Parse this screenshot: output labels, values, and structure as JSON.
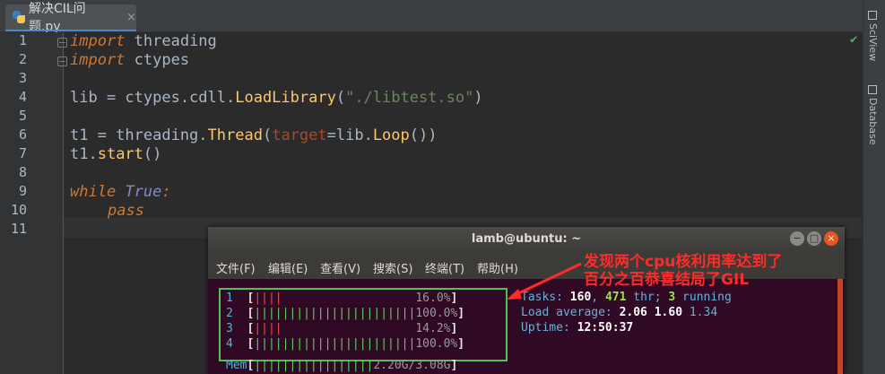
{
  "editor": {
    "tab": {
      "title": "解决CIL问题.py",
      "close": "×"
    },
    "side_tools": [
      "SciView",
      "Database"
    ],
    "line_numbers": [
      "1",
      "2",
      "3",
      "4",
      "5",
      "6",
      "7",
      "8",
      "9",
      "10",
      "11"
    ],
    "code": {
      "l1_kw": "import",
      "l1_rest": " threading",
      "l2_kw": "import",
      "l2_rest": " ctypes",
      "l4_a": "lib = ctypes.cdll.",
      "l4_fn": "LoadLibrary",
      "l4_b": "(",
      "l4_str": "\"./libtest.so\"",
      "l4_c": ")",
      "l6_a": "t1 = threading.",
      "l6_fn": "Thread",
      "l6_b": "(",
      "l6_par": "target",
      "l6_c": "=lib.",
      "l6_meth": "Loop",
      "l6_d": "())",
      "l7_a": "t1.",
      "l7_meth": "start",
      "l7_b": "()",
      "l9_kw": "while",
      "l9_sp": " ",
      "l9_true": "True",
      "l9_colon": ":",
      "l10_kw": "pass"
    }
  },
  "terminal": {
    "title": "lamb@ubuntu: ~",
    "buttons": [
      "−",
      "□",
      "×"
    ],
    "menu": [
      "文件(F)",
      "编辑(E)",
      "查看(V)",
      "搜索(S)",
      "终端(T)",
      "帮助(H)"
    ],
    "cpus": [
      {
        "num": "1",
        "bars_red": "||||",
        "bars_green": "",
        "pct": "16.0%",
        "value": 16.0
      },
      {
        "num": "2",
        "bars_red": "",
        "bars_green": "|||||||||||||||||||||||",
        "pct": "100.0%",
        "value": 100.0
      },
      {
        "num": "3",
        "bars_red": "||||",
        "bars_green": "",
        "pct": "14.2%",
        "value": 14.2
      },
      {
        "num": "4",
        "bars_red": "",
        "bars_green": "|||||||||||||||||||||||",
        "pct": "100.0%",
        "value": 100.0
      }
    ],
    "tasks_label": "Tasks: ",
    "tasks": "160",
    "sep": ", ",
    "thr": "471",
    "thr_label": " thr; ",
    "running": "3",
    "running_label": " running",
    "load_label": "Load average: ",
    "load1": "2.06",
    "load5": "1.60",
    "load15": "1.34",
    "uptime_label": "Uptime: ",
    "uptime": "12:50:37",
    "mem_label": "Mem",
    "mem_bars": "|||||||||||||||||",
    "mem_used": "2.20G",
    "mem_slash": "/",
    "mem_total": "3.08G"
  },
  "annotation": {
    "line1": "发现两个cpu核利用率达到了",
    "line2": "百分之百恭喜结局了GIL"
  },
  "colors": {
    "accent": "#e95420",
    "annotation": "#ff2a2a",
    "highlight_box": "#4fc24f"
  }
}
